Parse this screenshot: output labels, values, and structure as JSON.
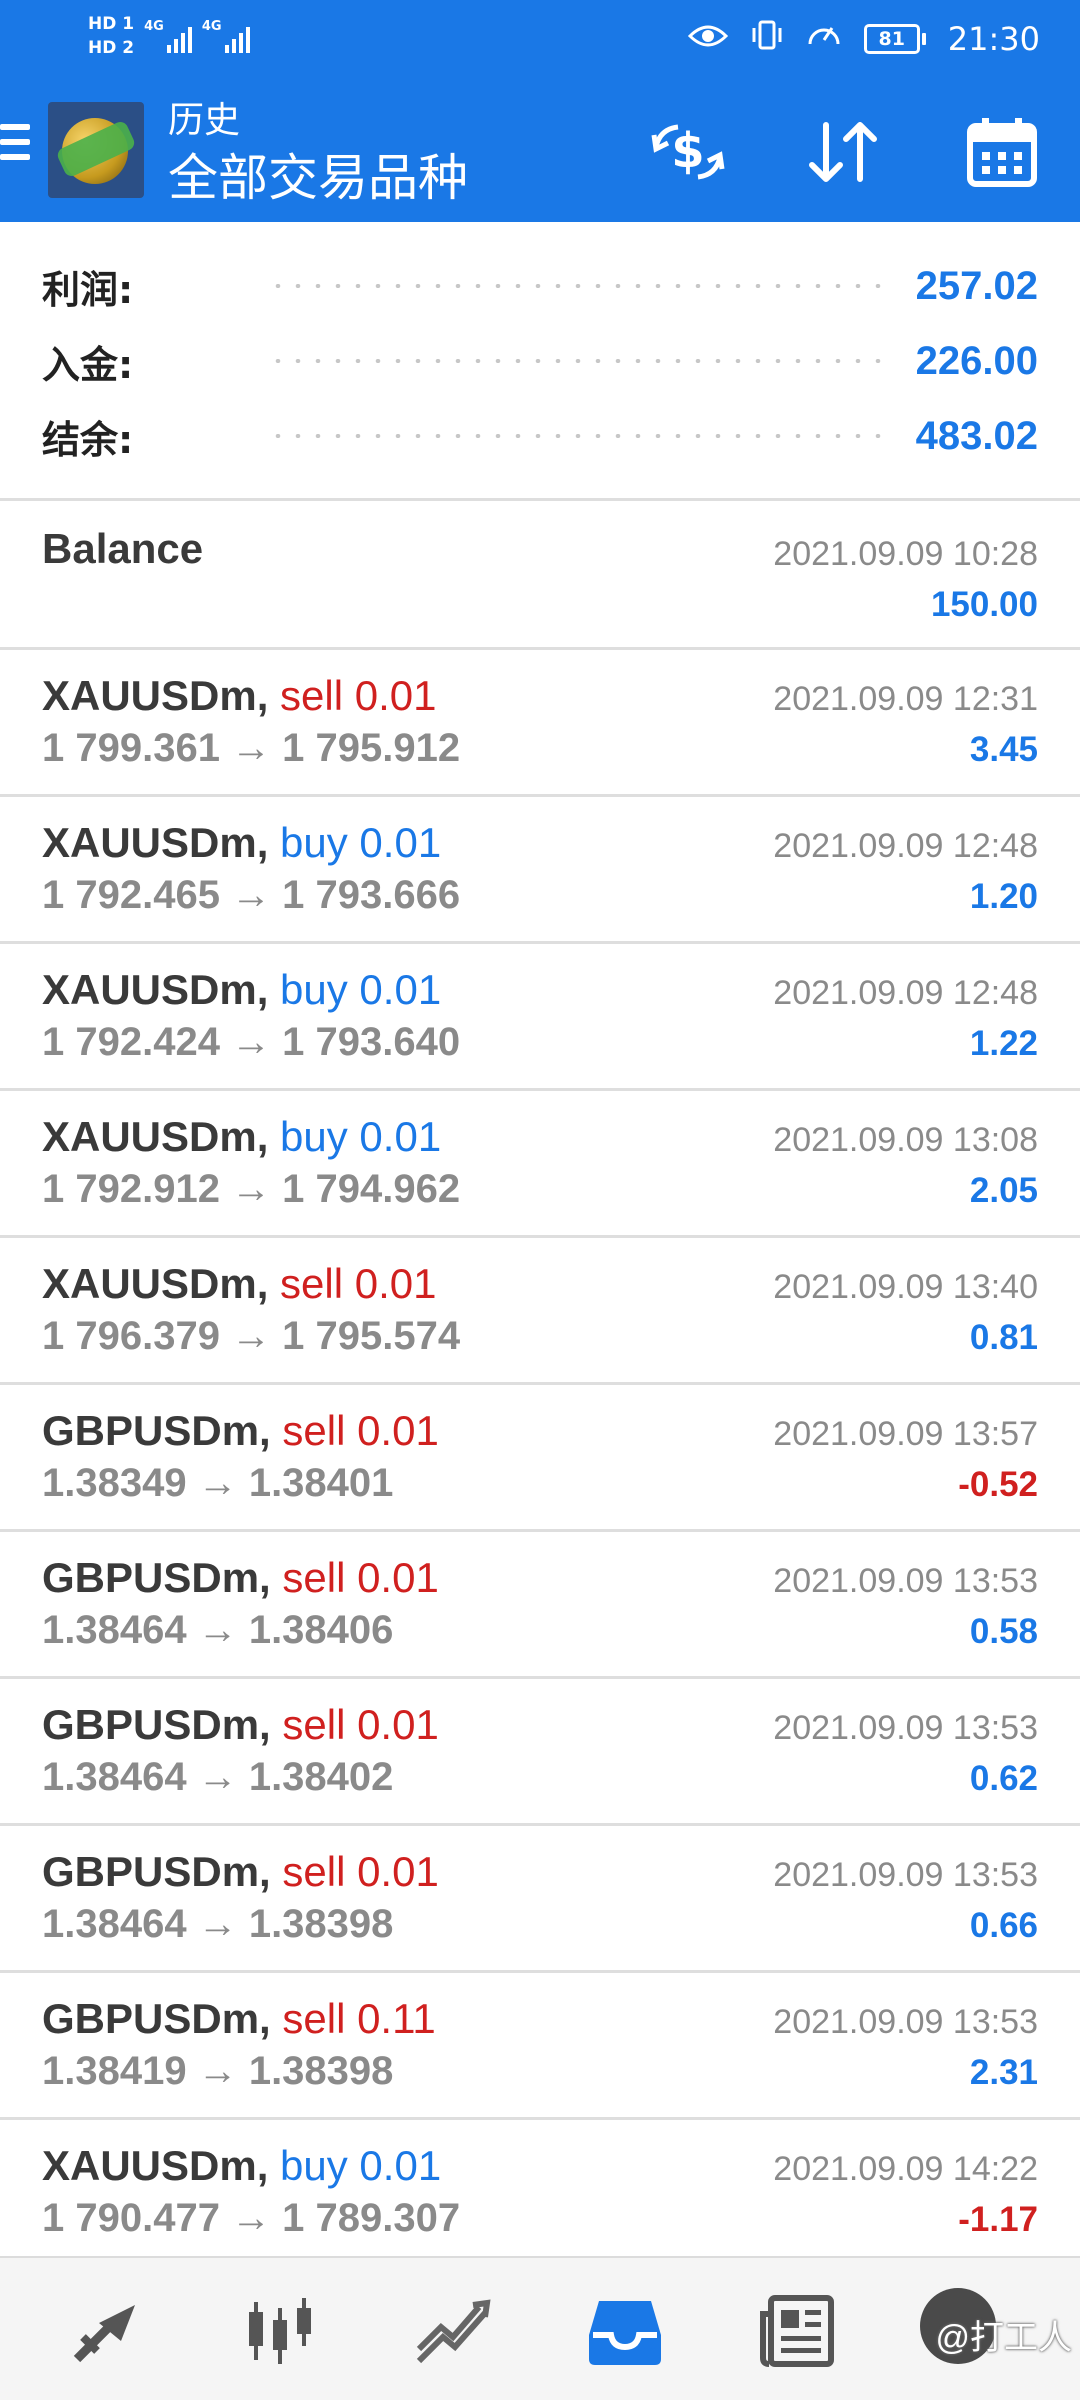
{
  "status_bar": {
    "hd1": "HD 1",
    "hd2": "HD 2",
    "net1": "4G",
    "net2": "4G",
    "battery": "81",
    "time": "21:30"
  },
  "header": {
    "title_small": "历史",
    "title_big": "全部交易品种",
    "icons": [
      "currency-exchange-icon",
      "sort-icon",
      "calendar-icon"
    ]
  },
  "summary": {
    "profit_label": "利润:",
    "profit_value": "257.02",
    "deposit_label": "入金:",
    "deposit_value": "226.00",
    "balance_label": "结余:",
    "balance_value": "483.02"
  },
  "balance_row": {
    "label": "Balance",
    "time": "2021.09.09 10:28",
    "amount": "150.00"
  },
  "trades": [
    {
      "symbol": "XAUUSDm,",
      "side": "sell 0.01",
      "type": "sell",
      "prices": "1 799.361 → 1 795.912",
      "time": "2021.09.09 12:31",
      "profit": "3.45",
      "negative": false
    },
    {
      "symbol": "XAUUSDm,",
      "side": "buy 0.01",
      "type": "buy",
      "prices": "1 792.465 → 1 793.666",
      "time": "2021.09.09 12:48",
      "profit": "1.20",
      "negative": false
    },
    {
      "symbol": "XAUUSDm,",
      "side": "buy 0.01",
      "type": "buy",
      "prices": "1 792.424 → 1 793.640",
      "time": "2021.09.09 12:48",
      "profit": "1.22",
      "negative": false
    },
    {
      "symbol": "XAUUSDm,",
      "side": "buy 0.01",
      "type": "buy",
      "prices": "1 792.912 → 1 794.962",
      "time": "2021.09.09 13:08",
      "profit": "2.05",
      "negative": false
    },
    {
      "symbol": "XAUUSDm,",
      "side": "sell 0.01",
      "type": "sell",
      "prices": "1 796.379 → 1 795.574",
      "time": "2021.09.09 13:40",
      "profit": "0.81",
      "negative": false
    },
    {
      "symbol": "GBPUSDm,",
      "side": "sell 0.01",
      "type": "sell",
      "prices": "1.38349 → 1.38401",
      "time": "2021.09.09 13:57",
      "profit": "-0.52",
      "negative": true
    },
    {
      "symbol": "GBPUSDm,",
      "side": "sell 0.01",
      "type": "sell",
      "prices": "1.38464 → 1.38406",
      "time": "2021.09.09 13:53",
      "profit": "0.58",
      "negative": false
    },
    {
      "symbol": "GBPUSDm,",
      "side": "sell 0.01",
      "type": "sell",
      "prices": "1.38464 → 1.38402",
      "time": "2021.09.09 13:53",
      "profit": "0.62",
      "negative": false
    },
    {
      "symbol": "GBPUSDm,",
      "side": "sell 0.01",
      "type": "sell",
      "prices": "1.38464 → 1.38398",
      "time": "2021.09.09 13:53",
      "profit": "0.66",
      "negative": false
    },
    {
      "symbol": "GBPUSDm,",
      "side": "sell 0.11",
      "type": "sell",
      "prices": "1.38419 → 1.38398",
      "time": "2021.09.09 13:53",
      "profit": "2.31",
      "negative": false
    },
    {
      "symbol": "XAUUSDm,",
      "side": "buy 0.01",
      "type": "buy",
      "prices": "1 790.477 → 1 789.307",
      "time": "2021.09.09 14:22",
      "profit": "-1.17",
      "negative": true
    }
  ],
  "bottom_nav": {
    "items": [
      "quotes-icon",
      "chart-icon",
      "trade-icon",
      "history-icon",
      "news-icon",
      "messages-icon"
    ],
    "active": "history-icon",
    "watermark": "@打工人"
  },
  "colors": {
    "accent": "#1a78e6",
    "sell": "#d0201f",
    "buy": "#1a78e6",
    "muted": "#8a8a8a"
  }
}
